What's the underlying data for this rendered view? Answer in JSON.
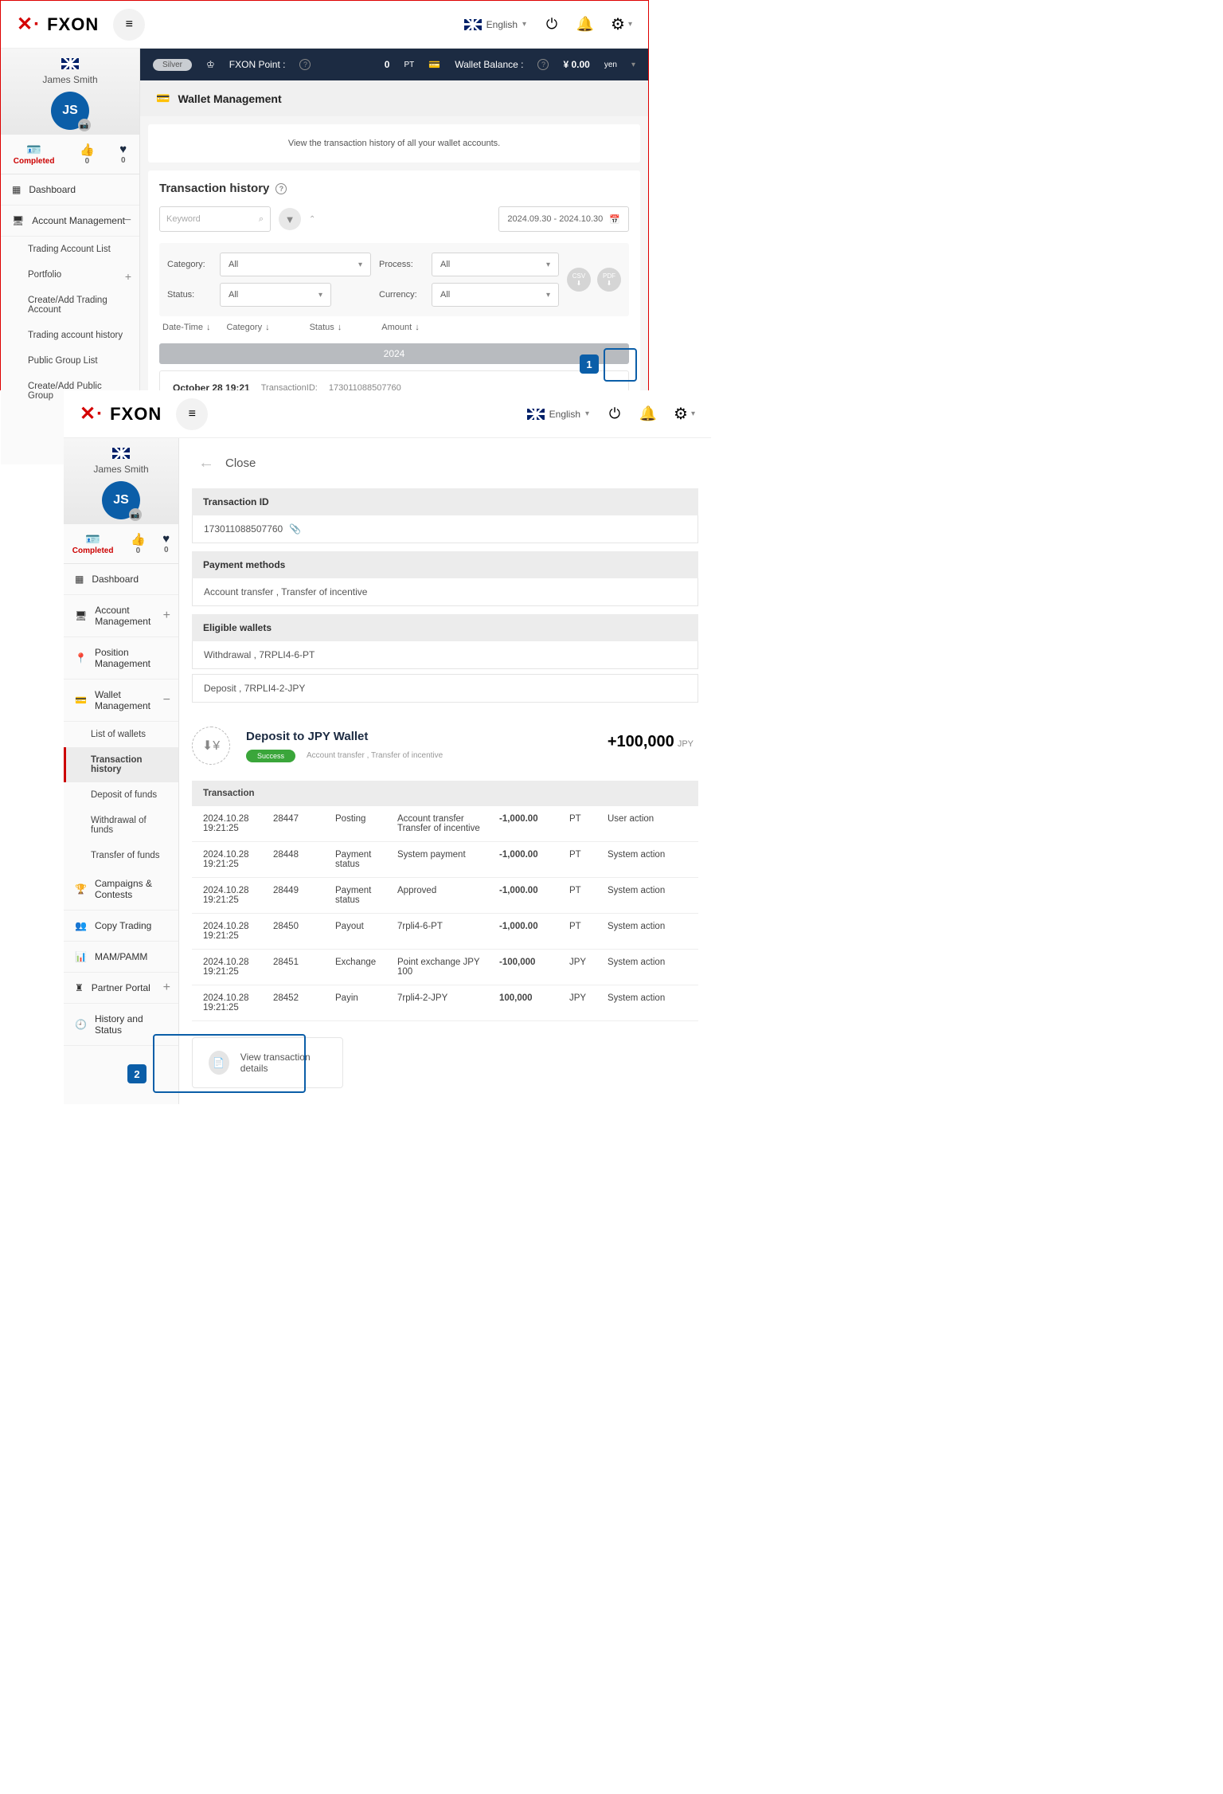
{
  "brand": "FXON",
  "lang": "English",
  "user": {
    "name": "James Smith",
    "initials": "JS",
    "completed": "Completed",
    "likes": "0",
    "hearts": "0"
  },
  "statbar": {
    "tier": "Silver",
    "points_label": "FXON Point :",
    "points": "0",
    "points_unit": "PT",
    "wallet_label": "Wallet Balance :",
    "wallet_amount": "¥ 0.00",
    "wallet_ccy": "yen"
  },
  "nav": {
    "dashboard": "Dashboard",
    "acct": "Account Management",
    "acct_sub": [
      "Trading Account List",
      "Portfolio",
      "Create/Add Trading Account",
      "Trading account history",
      "Public Group List",
      "Create/Add Public Group"
    ],
    "position": "Position Management",
    "wallet": "Wallet Management",
    "wallet_sub": [
      "List of wallets",
      "Transaction history",
      "Deposit of funds",
      "Withdrawal of funds",
      "Transfer of funds"
    ],
    "campaigns": "Campaigns & Contests",
    "copy": "Copy Trading",
    "mam": "MAM/PAMM",
    "partner": "Partner Portal",
    "history": "History and Status"
  },
  "page": {
    "title": "Wallet Management",
    "banner": "View the transaction history of all your wallet accounts.",
    "section": "Transaction history",
    "keyword": "Keyword",
    "daterange": "2024.09.30 - 2024.10.30",
    "labels": {
      "category": "Category:",
      "process": "Process:",
      "status": "Status:",
      "currency": "Currency:",
      "all": "All"
    },
    "sort": {
      "dt": "Date-Time",
      "cat": "Category",
      "status": "Status",
      "amount": "Amount"
    },
    "year": "2024",
    "csv": "CSV",
    "pdf": "PDF"
  },
  "tx": {
    "date": "October 28 19:21",
    "txid_label": "TransactionID:",
    "txid": "173011088507760",
    "title": "Deposit to JPY Wallet",
    "status": "Success",
    "desc": "Account transfer , Transfer of incentive",
    "amount": "+100,000",
    "ccy": "JPY"
  },
  "detail": {
    "close": "Close",
    "txid_label": "Transaction ID",
    "txid": "173011088507760",
    "pm_label": "Payment methods",
    "pm": "Account transfer , Transfer of incentive",
    "ew_label": "Eligible wallets",
    "ew1": "Withdrawal , 7RPLI4-6-PT",
    "ew2": "Deposit , 7RPLI4-2-JPY",
    "table_label": "Transaction",
    "rows": [
      {
        "dt": "2024.10.28 19:21:25",
        "id": "28447",
        "type": "Posting",
        "desc": "Account transfer Transfer of incentive",
        "amt": "-1,000.00",
        "ccy": "PT",
        "who": "User action"
      },
      {
        "dt": "2024.10.28 19:21:25",
        "id": "28448",
        "type": "Payment status",
        "desc": "System payment",
        "amt": "-1,000.00",
        "ccy": "PT",
        "who": "System action"
      },
      {
        "dt": "2024.10.28 19:21:25",
        "id": "28449",
        "type": "Payment status",
        "desc": "Approved",
        "amt": "-1,000.00",
        "ccy": "PT",
        "who": "System action"
      },
      {
        "dt": "2024.10.28 19:21:25",
        "id": "28450",
        "type": "Payout",
        "desc": "7rpli4-6-PT",
        "amt": "-1,000.00",
        "ccy": "PT",
        "who": "System action"
      },
      {
        "dt": "2024.10.28 19:21:25",
        "id": "28451",
        "type": "Exchange",
        "desc": "Point exchange JPY 100",
        "amt": "-100,000",
        "ccy": "JPY",
        "who": "System action"
      },
      {
        "dt": "2024.10.28 19:21:25",
        "id": "28452",
        "type": "Payin",
        "desc": "7rpli4-2-JPY",
        "amt": "100,000",
        "ccy": "JPY",
        "who": "System action"
      }
    ],
    "viewdet": "View transaction details"
  }
}
